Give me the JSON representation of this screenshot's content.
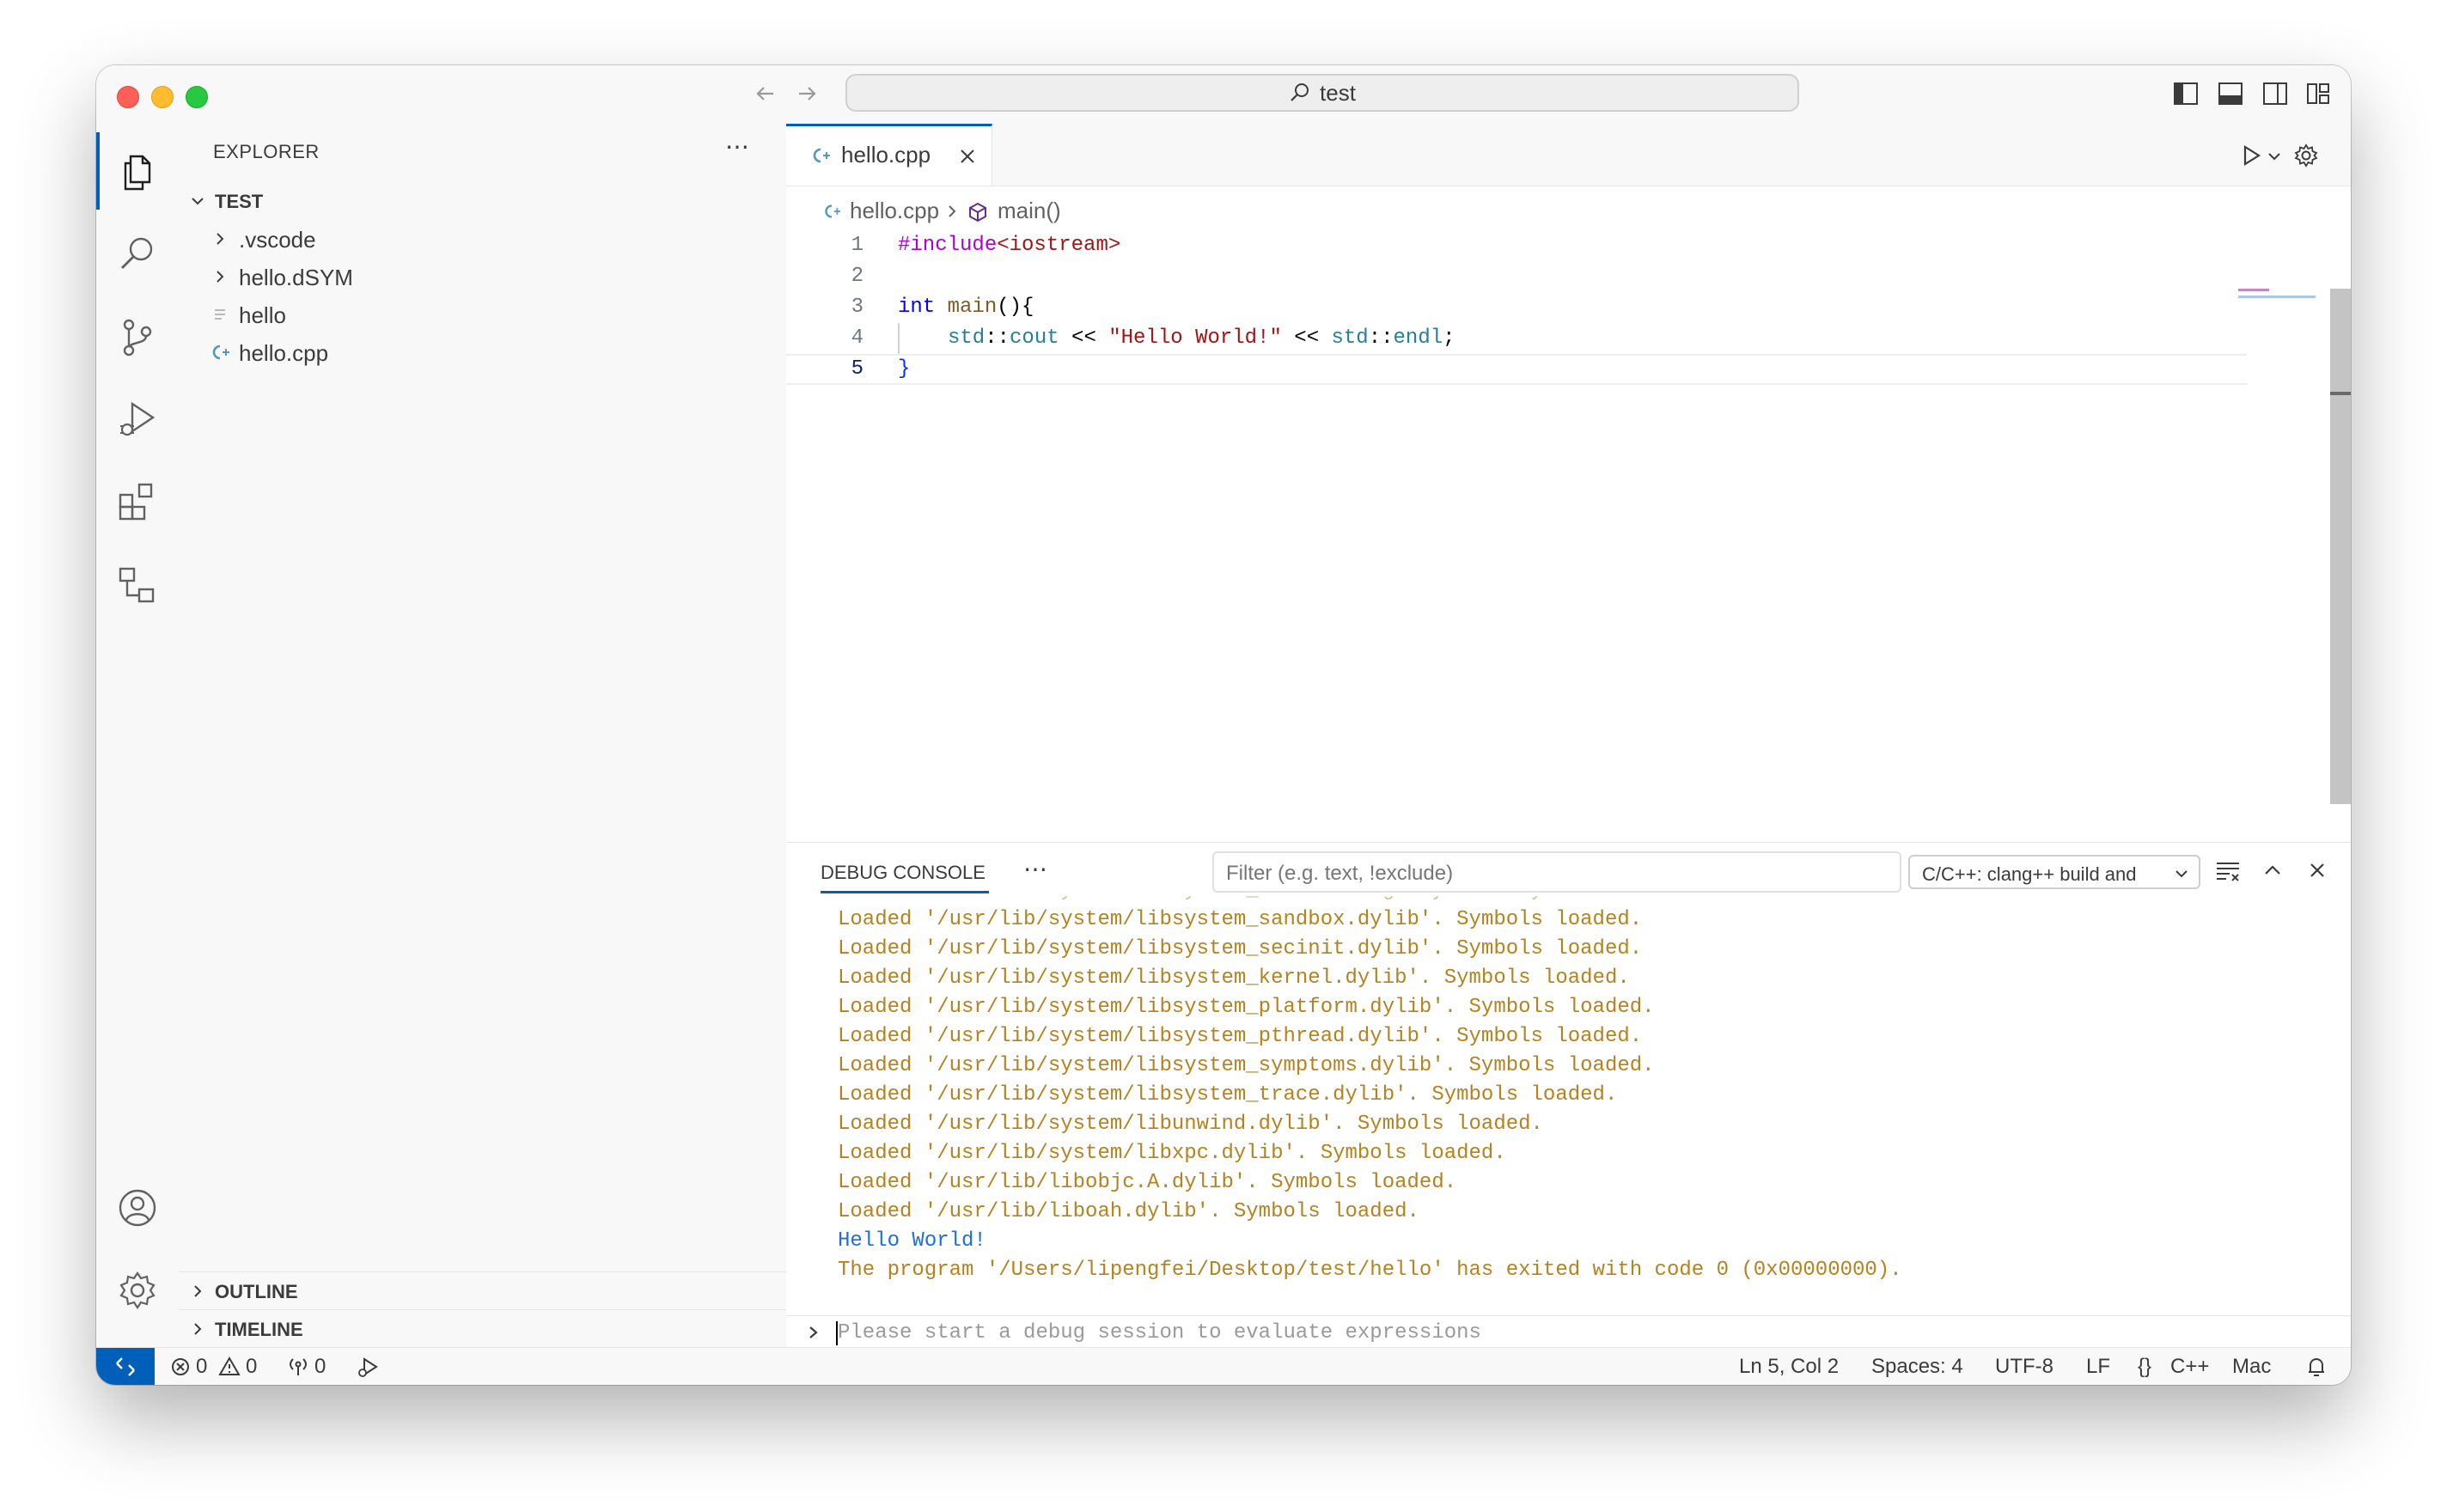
{
  "title_bar": {
    "search_text": "test"
  },
  "sidebar": {
    "title": "EXPLORER",
    "folder": "TEST",
    "items": [
      {
        "label": ".vscode",
        "kind": "folder"
      },
      {
        "label": "hello.dSYM",
        "kind": "folder"
      },
      {
        "label": "hello",
        "kind": "file"
      },
      {
        "label": "hello.cpp",
        "kind": "cpp-file"
      }
    ],
    "sections": [
      {
        "label": "OUTLINE"
      },
      {
        "label": "TIMELINE"
      }
    ]
  },
  "editor": {
    "tab_label": "hello.cpp",
    "breadcrumb": {
      "file": "hello.cpp",
      "symbol": "main()"
    },
    "line_numbers": [
      "1",
      "2",
      "3",
      "4",
      "5"
    ],
    "code": {
      "l1_pp": "#include",
      "l1_rest": "<iostream>",
      "l3_kw": "int",
      "l3_fn": " main",
      "l3_rest": "(){",
      "l4_ns1": "std",
      "l4_sep1": "::",
      "l4_id1": "cout",
      "l4_op1": " << ",
      "l4_str": "\"Hello World!\"",
      "l4_op2": " << ",
      "l4_ns2": "std",
      "l4_sep2": "::",
      "l4_id2": "endl",
      "l4_end": ";",
      "l5": "}"
    }
  },
  "panel": {
    "title": "DEBUG CONSOLE",
    "filter_placeholder": "Filter (e.g. text, !exclude)",
    "config_dropdown": "C/C++: clang++ build and",
    "console_lines": [
      {
        "text": "Loaded '/usr/lib/system/libsystem_sandbox.dylib'. Symbols loaded."
      },
      {
        "text": "Loaded '/usr/lib/system/libsystem_secinit.dylib'. Symbols loaded."
      },
      {
        "text": "Loaded '/usr/lib/system/libsystem_kernel.dylib'. Symbols loaded."
      },
      {
        "text": "Loaded '/usr/lib/system/libsystem_platform.dylib'. Symbols loaded."
      },
      {
        "text": "Loaded '/usr/lib/system/libsystem_pthread.dylib'. Symbols loaded."
      },
      {
        "text": "Loaded '/usr/lib/system/libsystem_symptoms.dylib'. Symbols loaded."
      },
      {
        "text": "Loaded '/usr/lib/system/libsystem_trace.dylib'. Symbols loaded."
      },
      {
        "text": "Loaded '/usr/lib/system/libunwind.dylib'. Symbols loaded."
      },
      {
        "text": "Loaded '/usr/lib/system/libxpc.dylib'. Symbols loaded."
      },
      {
        "text": "Loaded '/usr/lib/libobjc.A.dylib'. Symbols loaded."
      },
      {
        "text": "Loaded '/usr/lib/liboah.dylib'. Symbols loaded."
      },
      {
        "text": "Hello World!"
      },
      {
        "text": "The program '/Users/lipengfei/Desktop/test/hello' has exited with code 0 (0x00000000)."
      }
    ],
    "repl_placeholder": "Please start a debug session to evaluate expressions"
  },
  "statusbar": {
    "errors": "0",
    "warnings": "0",
    "ports": "0",
    "position": "Ln 5, Col 2",
    "spaces": "Spaces: 4",
    "encoding": "UTF-8",
    "eol": "LF",
    "language": "C++",
    "layout": "Mac"
  },
  "colors": {
    "accent": "#005fb8",
    "console_text": "#b5821e",
    "console_output": "#1c6ede"
  }
}
